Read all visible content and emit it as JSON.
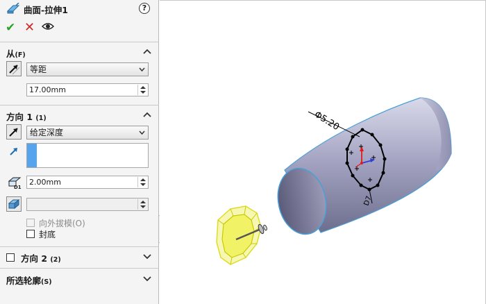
{
  "panel": {
    "title": "曲面-拉伸1",
    "help_glyph": "?",
    "actions": {
      "ok_glyph": "✔",
      "cancel_glyph": "✕"
    },
    "from_section": {
      "label": "从",
      "key": "(F)",
      "combo_value": "等距",
      "distance_value": "17.00mm"
    },
    "direction1_section": {
      "label": "方向 1",
      "key": "(1)",
      "end_condition": "给定深度",
      "depth_label": "D1",
      "depth_value": "2.00mm",
      "draft_value": "",
      "draft_outward_label": "向外拔模(O)",
      "draft_outward_checked": false,
      "cap_end_label": "封底",
      "cap_end_checked": false
    },
    "direction2_section": {
      "label": "方向 2",
      "key": "(2)",
      "checked": false
    },
    "selected_contours_section": {
      "label": "所选轮廓",
      "key": "(S)"
    }
  },
  "viewport": {
    "dimension_diameter": "Φ5.20",
    "dimension_small": "D7",
    "colors": {
      "surface": "#a9a9c4",
      "surface_edge": "#4a9fd8",
      "preview": "#f2f266",
      "preview_edge": "#d8d800",
      "sketch": "#000000",
      "origin_x": "#e01b1b",
      "origin_y": "#2c3fd8"
    }
  }
}
